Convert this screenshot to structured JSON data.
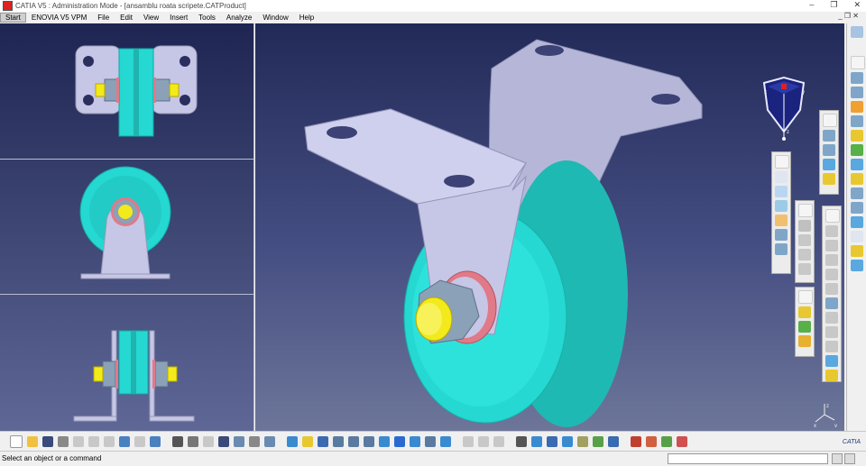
{
  "window": {
    "title": "CATIA V5 : Administration Mode - [ansamblu roata scripete.CATProduct]",
    "controls": [
      "–",
      "❐",
      "✕"
    ]
  },
  "menu": {
    "items": [
      "Start",
      "ENOVIA V5 VPM",
      "File",
      "Edit",
      "View",
      "Insert",
      "Tools",
      "Analyze",
      "Window",
      "Help"
    ],
    "right_controls": "_ ❐ ✕"
  },
  "viewer": {
    "compass_labels": [
      "x",
      "y",
      "z"
    ],
    "axis_labels": [
      "x",
      "y",
      "z"
    ]
  },
  "status": {
    "message": "Select an object or a command",
    "command_input": ""
  },
  "bottom_toolbar": {
    "brand": "CATIA"
  },
  "colors": {
    "part_body": "#c6c6e6",
    "pulley": "#25d8d2",
    "bolt": "#f2ea1a",
    "nut": "#8aa1b8",
    "washer": "#e07a88"
  },
  "icons": {
    "bottom": [
      "new-icon",
      "open-icon",
      "save-icon",
      "print-icon",
      "cut-icon",
      "copy-icon",
      "paste-icon",
      "undo-icon",
      "redo-icon",
      "help-icon",
      "formula-icon",
      "comment-icon",
      "measure-icon",
      "table-icon",
      "tree-icon",
      "properties-icon",
      "catalog-icon",
      "fly-icon",
      "fit-all-icon",
      "pan-icon",
      "rotate-icon",
      "zoom-in-icon",
      "zoom-out-icon",
      "normal-view-icon",
      "iso-view-icon",
      "shading-icon",
      "hide-icon",
      "swap-icon",
      "section-icon",
      "clash-icon",
      "snap-icon",
      "explode-icon",
      "compass-icon",
      "measure-between-icon",
      "annotation-icon",
      "scene-icon",
      "update-icon",
      "material-icon",
      "render-icon",
      "catalog-browser-icon",
      "grid-icon"
    ],
    "right": [
      "compass-reset-icon",
      "sketch-icon",
      "part-icon",
      "assembly-icon",
      "drafting-icon",
      "analysis-icon",
      "knowledge-icon",
      "constraints-icon",
      "fix-icon",
      "contact-icon",
      "offset-icon",
      "angle-icon",
      "text-icon",
      "reuse-icon",
      "catalog-icon"
    ]
  }
}
